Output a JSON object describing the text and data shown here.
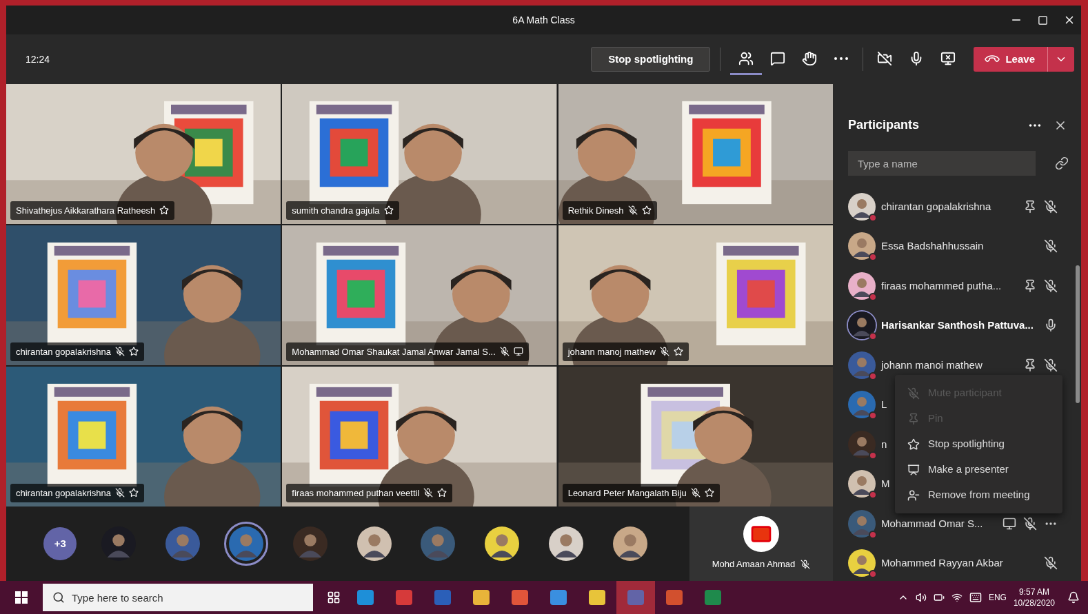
{
  "window": {
    "title": "6A Math Class"
  },
  "toolbar": {
    "time": "12:24",
    "spotlight_button": "Stop spotlighting",
    "buttons": [
      {
        "kind": "participants",
        "selected": true
      },
      {
        "kind": "chat",
        "selected": false
      },
      {
        "kind": "hand",
        "selected": false
      },
      {
        "kind": "more",
        "selected": false
      },
      {
        "kind": "camera_off",
        "selected": false
      },
      {
        "kind": "mic",
        "selected": false
      },
      {
        "kind": "share",
        "selected": false
      }
    ],
    "leave_button": "Leave"
  },
  "tiles": [
    {
      "name": "Shivathejus Aikkarathara Ratheesh",
      "muted": false,
      "spotlighted": true,
      "sharing": false
    },
    {
      "name": "sumith chandra gajula",
      "muted": false,
      "spotlighted": true,
      "sharing": false
    },
    {
      "name": "Rethik Dinesh",
      "muted": true,
      "spotlighted": true,
      "sharing": false
    },
    {
      "name": "chirantan gopalakrishna",
      "muted": true,
      "spotlighted": true,
      "sharing": false
    },
    {
      "name": "Mohammad Omar Shaukat Jamal Anwar Jamal S...",
      "muted": true,
      "spotlighted": false,
      "sharing": true
    },
    {
      "name": "johann manoj mathew",
      "muted": true,
      "spotlighted": true,
      "sharing": false
    },
    {
      "name": "chirantan gopalakrishna",
      "muted": true,
      "spotlighted": true,
      "sharing": false
    },
    {
      "name": "firaas mohammed puthan veettil",
      "muted": true,
      "spotlighted": true,
      "sharing": false
    },
    {
      "name": "Leonard Peter Mangalath Biju",
      "muted": true,
      "spotlighted": true,
      "sharing": false
    }
  ],
  "strip": {
    "overflow": "+3",
    "avatars": [
      {
        "selected": false
      },
      {
        "selected": false
      },
      {
        "selected": true
      },
      {
        "selected": false
      },
      {
        "selected": false
      },
      {
        "selected": false
      },
      {
        "selected": false
      },
      {
        "selected": false
      },
      {
        "selected": false
      }
    ],
    "pinned": {
      "name": "Mohd Amaan Ahmad",
      "muted": true
    }
  },
  "participants": {
    "title": "Participants",
    "search": {
      "placeholder": "Type a name"
    },
    "rows": [
      {
        "name": "chirantan gopalakrishna",
        "speaking": false,
        "pinnable": true,
        "muted": true
      },
      {
        "name": "Essa Badshahhussain",
        "speaking": false,
        "pinnable": false,
        "muted": true
      },
      {
        "name": "firaas mohammed putha...",
        "speaking": false,
        "pinnable": true,
        "muted": true
      },
      {
        "name": "Harisankar Santhosh Pattuva...",
        "speaking": true,
        "pinnable": false,
        "muted": false
      },
      {
        "name": "johann manoi mathew",
        "speaking": false,
        "pinnable": true,
        "muted": true
      },
      {
        "name": "L",
        "speaking": false
      },
      {
        "name": "n",
        "speaking": false
      },
      {
        "name": "M",
        "speaking": false
      },
      {
        "name": "Mohammad Omar S...",
        "speaking": false,
        "sharing": true,
        "muted": true,
        "more": true
      },
      {
        "name": "Mohammed Rayyan Akbar",
        "speaking": false,
        "pinnable": false,
        "muted": true
      }
    ],
    "menu": [
      {
        "kind": "mute",
        "label": "Mute participant",
        "disabled": true
      },
      {
        "kind": "pin",
        "label": "Pin",
        "disabled": true
      },
      {
        "kind": "spotlight",
        "label": "Stop spotlighting",
        "disabled": false
      },
      {
        "kind": "presenter",
        "label": "Make a presenter",
        "disabled": false
      },
      {
        "kind": "remove",
        "label": "Remove from meeting",
        "disabled": false
      }
    ]
  },
  "taskbar": {
    "search": {
      "placeholder": "Type here to search"
    },
    "apps": [
      {
        "color": "#1e8fd8",
        "active": false
      },
      {
        "color": "#d63a3a",
        "active": false
      },
      {
        "color": "#2b5fb8",
        "active": false
      },
      {
        "color": "#e8b43a",
        "active": false
      },
      {
        "color": "#e0553a",
        "active": false
      },
      {
        "color": "#3a8fe0",
        "active": false
      },
      {
        "color": "#e8c43a",
        "active": false
      },
      {
        "color": "#6264a7",
        "active": true
      },
      {
        "color": "#d2502e",
        "active": false
      },
      {
        "color": "#1f8a4c",
        "active": false
      }
    ],
    "language": "ENG",
    "time": "9:57 AM",
    "date": "10/28/2020"
  }
}
